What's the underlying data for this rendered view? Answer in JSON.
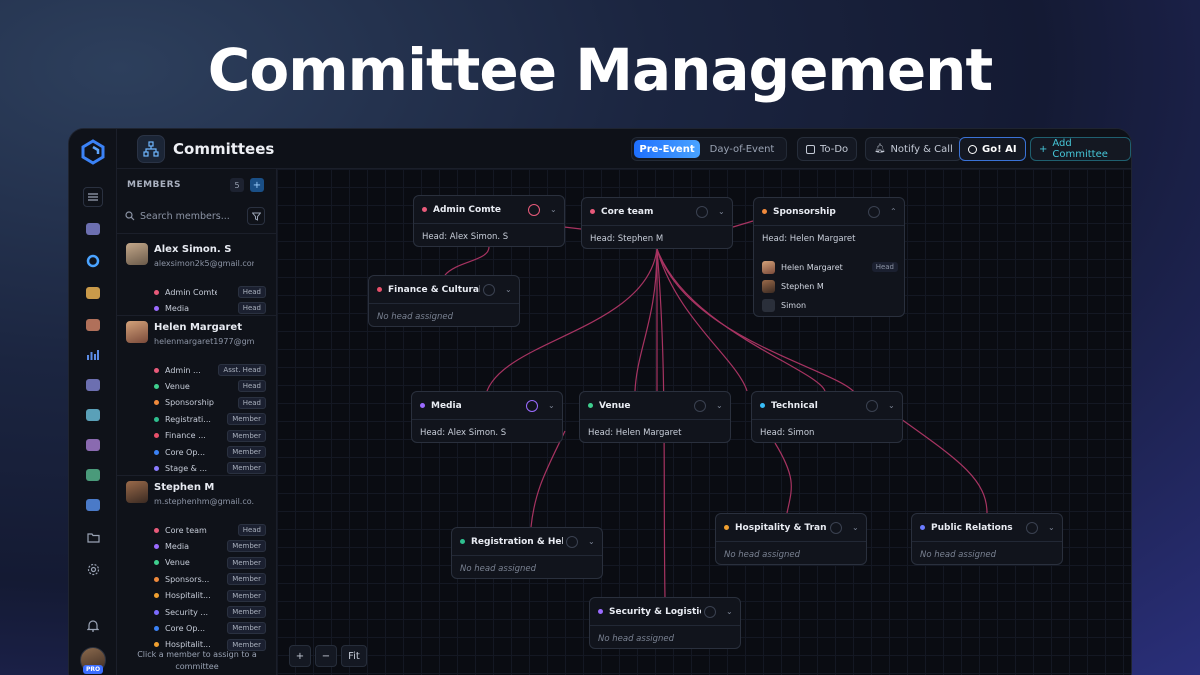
{
  "hero": {
    "title": "Committee Management"
  },
  "topbar": {
    "title": "Committees",
    "seg_active": "Pre-Event",
    "seg_inactive": "Day-of-Event",
    "todo": "To-Do",
    "notify": "Notify & Call",
    "goai": "Go! AI",
    "add": "Add Committee"
  },
  "members_panel": {
    "header": "MEMBERS",
    "count": "5",
    "search_placeholder": "Search members...",
    "footer": "Click a member to assign to a committee",
    "members": [
      {
        "name": "Alex Simon. S",
        "email": "alexsimon2k5@gmail.com",
        "committees": [
          {
            "name": "Admin Comte",
            "role": "Head",
            "color": "#e85a7a"
          },
          {
            "name": "Media",
            "role": "Head",
            "color": "#9b6bff"
          }
        ]
      },
      {
        "name": "Helen Margaret",
        "email": "helenmargaret1977@gm...",
        "committees": [
          {
            "name": "Admin ...",
            "role": "Asst. Head",
            "color": "#e85a7a"
          },
          {
            "name": "Venue",
            "role": "Head",
            "color": "#3fcf8e"
          },
          {
            "name": "Sponsorship",
            "role": "Head",
            "color": "#f08a3c"
          },
          {
            "name": "Registrati...",
            "role": "Member",
            "color": "#2fbf8f"
          },
          {
            "name": "Finance ...",
            "role": "Member",
            "color": "#e8506a"
          },
          {
            "name": "Core Op...",
            "role": "Member",
            "color": "#3b82f6"
          },
          {
            "name": "Stage & ...",
            "role": "Member",
            "color": "#8b7bff"
          }
        ]
      },
      {
        "name": "Stephen M",
        "email": "m.stephenhm@gmail.co...",
        "committees": [
          {
            "name": "Core team",
            "role": "Head",
            "color": "#e85a7a"
          },
          {
            "name": "Media",
            "role": "Member",
            "color": "#9b6bff"
          },
          {
            "name": "Venue",
            "role": "Member",
            "color": "#3fcf8e"
          },
          {
            "name": "Sponsors...",
            "role": "Member",
            "color": "#f08a3c"
          },
          {
            "name": "Hospitalit...",
            "role": "Member",
            "color": "#f0a030"
          },
          {
            "name": "Security ...",
            "role": "Member",
            "color": "#7b6bff"
          },
          {
            "name": "Core Op...",
            "role": "Member",
            "color": "#3b82f6"
          },
          {
            "name": "Hospitalit...",
            "role": "Member",
            "color": "#f0a030"
          }
        ]
      }
    ]
  },
  "nodes": {
    "admin": {
      "title": "Admin Comte",
      "head": "Head: Alex Simon. S",
      "color": "#e85a7a"
    },
    "core": {
      "title": "Core team",
      "head": "Head: Stephen M",
      "color": "#e85a7a"
    },
    "sponsorship": {
      "title": "Sponsorship",
      "head": "Head: Helen Margaret",
      "color": "#f08a3c",
      "members": [
        {
          "name": "Helen Margaret",
          "badge": "Head"
        },
        {
          "name": "Stephen M"
        },
        {
          "name": "Simon"
        }
      ]
    },
    "finance": {
      "title": "Finance & Culturals ...",
      "head": "No head assigned",
      "color": "#e8506a"
    },
    "media": {
      "title": "Media",
      "head": "Head: Alex Simon. S",
      "color": "#9b6bff"
    },
    "venue": {
      "title": "Venue",
      "head": "Head: Helen Margaret",
      "color": "#3fcf8e"
    },
    "technical": {
      "title": "Technical",
      "head": "Head: Simon",
      "color": "#38bdf8"
    },
    "registration": {
      "title": "Registration & Helpd...",
      "head": "No head assigned",
      "color": "#2fbf8f"
    },
    "hospitality": {
      "title": "Hospitality & Transp...",
      "head": "No head assigned",
      "color": "#f0a030"
    },
    "pr": {
      "title": "Public Relations",
      "head": "No head assigned",
      "color": "#6b7bff"
    },
    "security": {
      "title": "Security & Logistics",
      "head": "No head assigned",
      "color": "#9b6bff"
    }
  },
  "zoom": {
    "in": "+",
    "out": "−",
    "fit": "Fit"
  },
  "colors": {
    "edge": "#b8386a",
    "accent": "#1e6fff"
  }
}
